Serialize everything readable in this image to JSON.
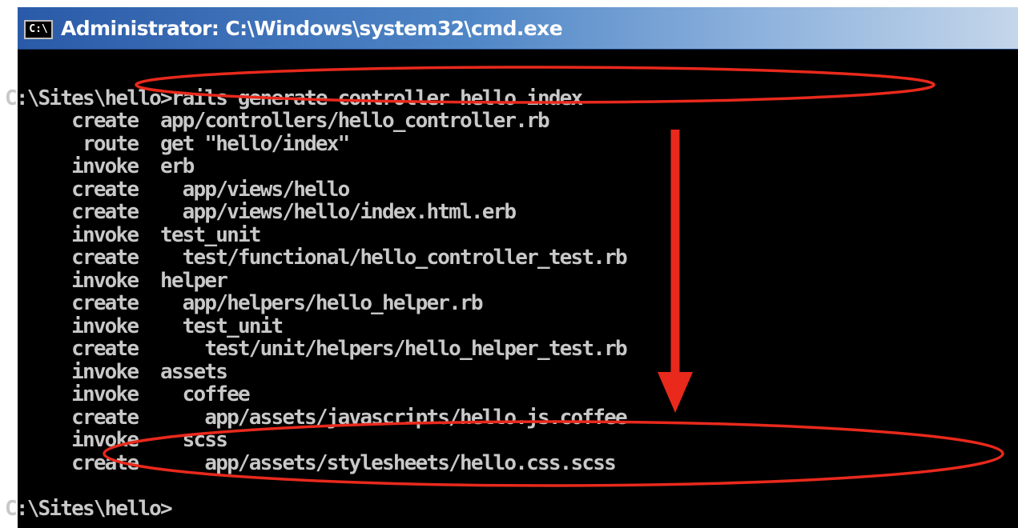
{
  "window": {
    "title": "Administrator: C:\\Windows\\system32\\cmd.exe",
    "icon": "cmd-icon",
    "icon_text": "C:\\"
  },
  "console": {
    "command_line": "C:\\Sites\\hello>rails generate controller hello index",
    "output": [
      {
        "action": "create",
        "path": "app/controllers/hello_controller.rb",
        "indent": 0
      },
      {
        "action": "route",
        "path": "get \"hello/index\"",
        "indent": 0
      },
      {
        "action": "invoke",
        "path": "erb",
        "indent": 0
      },
      {
        "action": "create",
        "path": "app/views/hello",
        "indent": 1
      },
      {
        "action": "create",
        "path": "app/views/hello/index.html.erb",
        "indent": 1
      },
      {
        "action": "invoke",
        "path": "test_unit",
        "indent": 0
      },
      {
        "action": "create",
        "path": "test/functional/hello_controller_test.rb",
        "indent": 1
      },
      {
        "action": "invoke",
        "path": "helper",
        "indent": 0
      },
      {
        "action": "create",
        "path": "app/helpers/hello_helper.rb",
        "indent": 1
      },
      {
        "action": "invoke",
        "path": "test_unit",
        "indent": 1
      },
      {
        "action": "create",
        "path": "test/unit/helpers/hello_helper_test.rb",
        "indent": 2
      },
      {
        "action": "invoke",
        "path": "assets",
        "indent": 0
      },
      {
        "action": "invoke",
        "path": "coffee",
        "indent": 1
      },
      {
        "action": "create",
        "path": "app/assets/javascripts/hello.js.coffee",
        "indent": 2
      },
      {
        "action": "invoke",
        "path": "scss",
        "indent": 1
      },
      {
        "action": "create",
        "path": "app/assets/stylesheets/hello.css.scss",
        "indent": 2
      }
    ],
    "prompt": "C:\\Sites\\hello>"
  },
  "colors": {
    "console_background": "#000000",
    "console_text": "#c8c8c8",
    "titlebar_start": "#2a5aa8",
    "titlebar_end": "#c4d6ea",
    "annotation": "#e8291c"
  }
}
